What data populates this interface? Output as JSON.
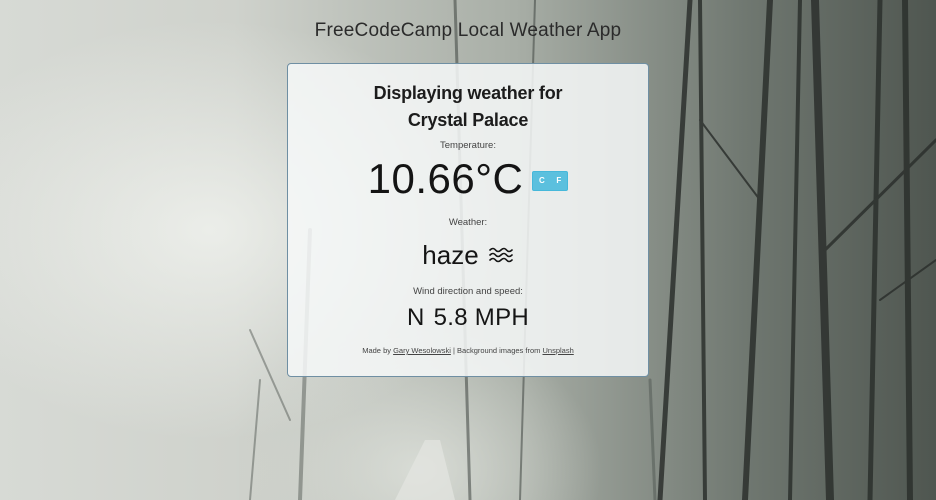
{
  "app": {
    "title": "FreeCodeCamp Local Weather App"
  },
  "card": {
    "heading_line1": "Displaying weather for",
    "location": "Crystal Palace",
    "temperature_label": "Temperature:",
    "temperature_value": "10.66°C",
    "unit_celsius": "C",
    "unit_fahrenheit": "F",
    "weather_label": "Weather:",
    "weather_description": "haze",
    "weather_icon": "haze-icon",
    "wind_label": "Wind direction and speed:",
    "wind_direction": "N",
    "wind_speed": "5.8 MPH"
  },
  "footer": {
    "made_by": "Made by",
    "author_link": "Gary Wesolowski",
    "separator": "| Background images from",
    "source_link": "Unsplash"
  },
  "colors": {
    "toggle_accent": "#5bc0de",
    "card_border": "#6f8fa3"
  }
}
